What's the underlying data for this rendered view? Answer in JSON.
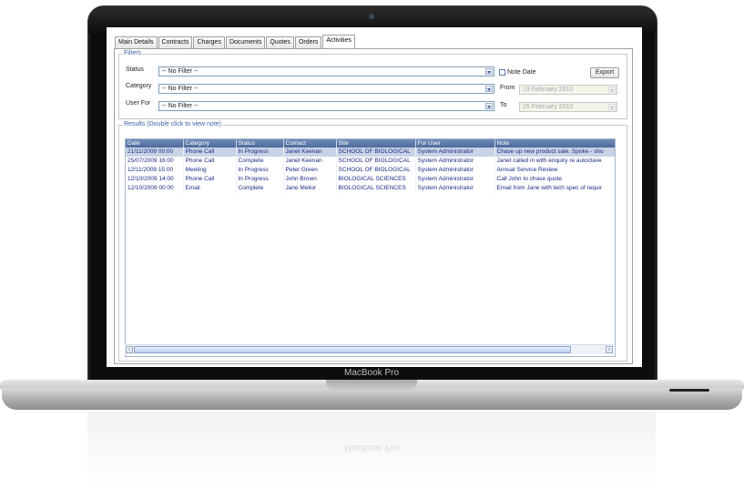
{
  "device": {
    "brand": "MacBook Pro"
  },
  "tabs": [
    "Main Details",
    "Contracts",
    "Charges",
    "Documents",
    "Quotes",
    "Orders",
    "Activities"
  ],
  "active_tab": "Activities",
  "filters": {
    "legend": "Filters",
    "status_label": "Status",
    "status_value": "-- No Filter --",
    "category_label": "Category",
    "category_value": "-- No Filter --",
    "user_label": "User For",
    "user_value": "-- No Filter --",
    "note_date_label": "Note Date",
    "note_date_checked": false,
    "export_label": "Export",
    "from_label": "From",
    "from_value": "19  February  2010",
    "to_label": "To",
    "to_value": "25  February  2010"
  },
  "results": {
    "legend": "Results (Double click to view note)",
    "columns": [
      "Date",
      "Category",
      "Status",
      "Contact",
      "Site",
      "For User",
      "Note"
    ],
    "rows": [
      [
        "21/11/2009 00:00",
        "Phone Call",
        "In Progress",
        "Janet Keenan",
        "SCHOOL OF BIOLOGICAL",
        "System Administrator",
        "Chase up new product sale. Spoke - sho"
      ],
      [
        "25/07/2009 16:00",
        "Phone Call",
        "Complete",
        "Janet Keenan",
        "SCHOOL OF BIOLOGICAL",
        "System Administrator",
        "Janet called in with enquiry re autoclave"
      ],
      [
        "12/11/2009 15:00",
        "Meeting",
        "In Progress",
        "Peter Green",
        "SCHOOL OF BIOLOGICAL",
        "System Administrator",
        "Annual Service Review"
      ],
      [
        "12/10/2009 14:00",
        "Phone Call",
        "In Progress",
        "John Brown",
        "BIOLOGICAL SCIENCES",
        "System Administrator",
        "Call John to chase quote"
      ],
      [
        "12/10/2009 00:00",
        "Email",
        "Complete",
        "Jane Mellor",
        "BIOLOGICAL SCIENCES",
        "System Administrator",
        "Email from Jane with tech spec of requir"
      ]
    ],
    "selected_row": 0
  },
  "icons": {
    "scroll_left": "‹",
    "scroll_right": "›"
  }
}
